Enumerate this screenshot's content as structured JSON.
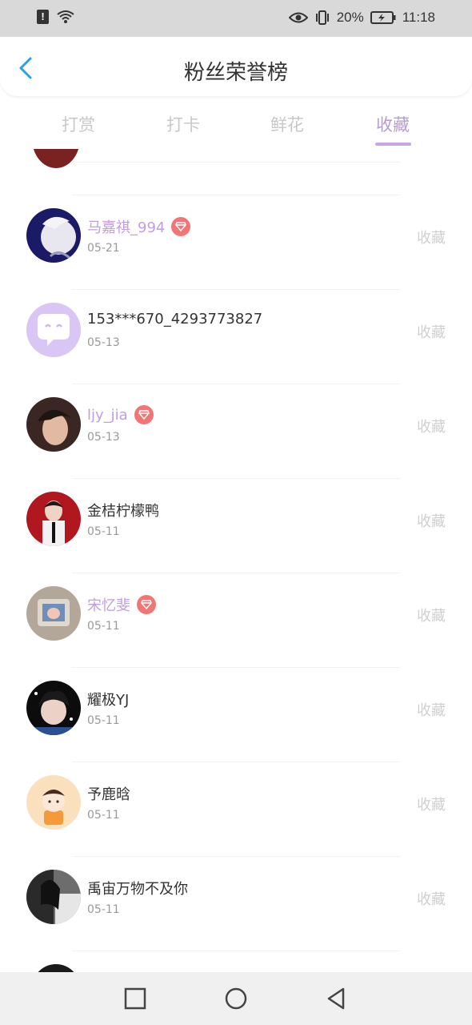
{
  "status_bar": {
    "battery": "20%",
    "time": "11:18"
  },
  "header": {
    "title": "粉丝荣誉榜"
  },
  "tabs": [
    {
      "label": "打赏"
    },
    {
      "label": "打卡"
    },
    {
      "label": "鲜花"
    },
    {
      "label": "收藏"
    }
  ],
  "active_tab": "收藏",
  "list": {
    "action_label": "收藏",
    "items": [
      {
        "name": "马嘉祺_994",
        "date": "05-21",
        "vip": true
      },
      {
        "name": "153***670_4293773827",
        "date": "05-13",
        "vip": false
      },
      {
        "name": "ljy_jia",
        "date": "05-13",
        "vip": true
      },
      {
        "name": "金桔柠檬鸭",
        "date": "05-11",
        "vip": false
      },
      {
        "name": "宋忆斐",
        "date": "05-11",
        "vip": true
      },
      {
        "name": "耀极YJ",
        "date": "05-11",
        "vip": false
      },
      {
        "name": "予鹿晗",
        "date": "05-11",
        "vip": false
      },
      {
        "name": "禹宙万物不及你",
        "date": "05-11",
        "vip": false
      }
    ]
  },
  "colors": {
    "accent": "#b99ad8",
    "vip_badge": "#f27575",
    "vip_name": "#c29de0"
  }
}
